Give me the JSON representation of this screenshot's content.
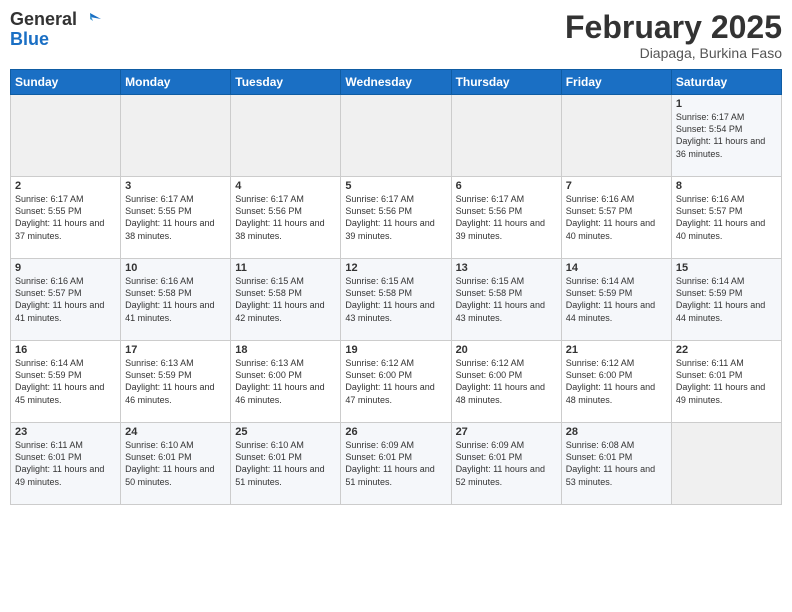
{
  "header": {
    "logo_general": "General",
    "logo_blue": "Blue",
    "month_title": "February 2025",
    "location": "Diapaga, Burkina Faso"
  },
  "calendar": {
    "days_of_week": [
      "Sunday",
      "Monday",
      "Tuesday",
      "Wednesday",
      "Thursday",
      "Friday",
      "Saturday"
    ],
    "weeks": [
      [
        {
          "day": "",
          "info": ""
        },
        {
          "day": "",
          "info": ""
        },
        {
          "day": "",
          "info": ""
        },
        {
          "day": "",
          "info": ""
        },
        {
          "day": "",
          "info": ""
        },
        {
          "day": "",
          "info": ""
        },
        {
          "day": "1",
          "info": "Sunrise: 6:17 AM\nSunset: 5:54 PM\nDaylight: 11 hours and 36 minutes."
        }
      ],
      [
        {
          "day": "2",
          "info": "Sunrise: 6:17 AM\nSunset: 5:55 PM\nDaylight: 11 hours and 37 minutes."
        },
        {
          "day": "3",
          "info": "Sunrise: 6:17 AM\nSunset: 5:55 PM\nDaylight: 11 hours and 38 minutes."
        },
        {
          "day": "4",
          "info": "Sunrise: 6:17 AM\nSunset: 5:56 PM\nDaylight: 11 hours and 38 minutes."
        },
        {
          "day": "5",
          "info": "Sunrise: 6:17 AM\nSunset: 5:56 PM\nDaylight: 11 hours and 39 minutes."
        },
        {
          "day": "6",
          "info": "Sunrise: 6:17 AM\nSunset: 5:56 PM\nDaylight: 11 hours and 39 minutes."
        },
        {
          "day": "7",
          "info": "Sunrise: 6:16 AM\nSunset: 5:57 PM\nDaylight: 11 hours and 40 minutes."
        },
        {
          "day": "8",
          "info": "Sunrise: 6:16 AM\nSunset: 5:57 PM\nDaylight: 11 hours and 40 minutes."
        }
      ],
      [
        {
          "day": "9",
          "info": "Sunrise: 6:16 AM\nSunset: 5:57 PM\nDaylight: 11 hours and 41 minutes."
        },
        {
          "day": "10",
          "info": "Sunrise: 6:16 AM\nSunset: 5:58 PM\nDaylight: 11 hours and 41 minutes."
        },
        {
          "day": "11",
          "info": "Sunrise: 6:15 AM\nSunset: 5:58 PM\nDaylight: 11 hours and 42 minutes."
        },
        {
          "day": "12",
          "info": "Sunrise: 6:15 AM\nSunset: 5:58 PM\nDaylight: 11 hours and 43 minutes."
        },
        {
          "day": "13",
          "info": "Sunrise: 6:15 AM\nSunset: 5:58 PM\nDaylight: 11 hours and 43 minutes."
        },
        {
          "day": "14",
          "info": "Sunrise: 6:14 AM\nSunset: 5:59 PM\nDaylight: 11 hours and 44 minutes."
        },
        {
          "day": "15",
          "info": "Sunrise: 6:14 AM\nSunset: 5:59 PM\nDaylight: 11 hours and 44 minutes."
        }
      ],
      [
        {
          "day": "16",
          "info": "Sunrise: 6:14 AM\nSunset: 5:59 PM\nDaylight: 11 hours and 45 minutes."
        },
        {
          "day": "17",
          "info": "Sunrise: 6:13 AM\nSunset: 5:59 PM\nDaylight: 11 hours and 46 minutes."
        },
        {
          "day": "18",
          "info": "Sunrise: 6:13 AM\nSunset: 6:00 PM\nDaylight: 11 hours and 46 minutes."
        },
        {
          "day": "19",
          "info": "Sunrise: 6:12 AM\nSunset: 6:00 PM\nDaylight: 11 hours and 47 minutes."
        },
        {
          "day": "20",
          "info": "Sunrise: 6:12 AM\nSunset: 6:00 PM\nDaylight: 11 hours and 48 minutes."
        },
        {
          "day": "21",
          "info": "Sunrise: 6:12 AM\nSunset: 6:00 PM\nDaylight: 11 hours and 48 minutes."
        },
        {
          "day": "22",
          "info": "Sunrise: 6:11 AM\nSunset: 6:01 PM\nDaylight: 11 hours and 49 minutes."
        }
      ],
      [
        {
          "day": "23",
          "info": "Sunrise: 6:11 AM\nSunset: 6:01 PM\nDaylight: 11 hours and 49 minutes."
        },
        {
          "day": "24",
          "info": "Sunrise: 6:10 AM\nSunset: 6:01 PM\nDaylight: 11 hours and 50 minutes."
        },
        {
          "day": "25",
          "info": "Sunrise: 6:10 AM\nSunset: 6:01 PM\nDaylight: 11 hours and 51 minutes."
        },
        {
          "day": "26",
          "info": "Sunrise: 6:09 AM\nSunset: 6:01 PM\nDaylight: 11 hours and 51 minutes."
        },
        {
          "day": "27",
          "info": "Sunrise: 6:09 AM\nSunset: 6:01 PM\nDaylight: 11 hours and 52 minutes."
        },
        {
          "day": "28",
          "info": "Sunrise: 6:08 AM\nSunset: 6:01 PM\nDaylight: 11 hours and 53 minutes."
        },
        {
          "day": "",
          "info": ""
        }
      ]
    ]
  }
}
